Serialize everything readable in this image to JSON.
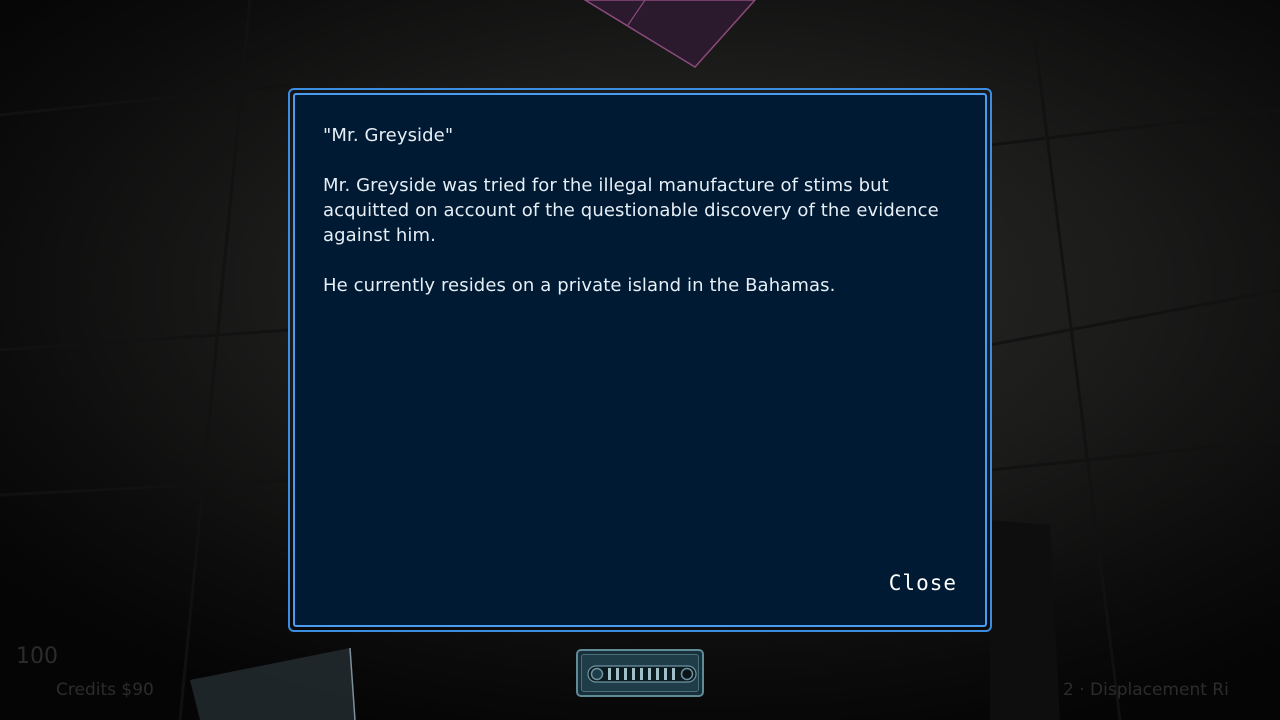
{
  "dialog": {
    "title": "\"Mr. Greyside\"",
    "paragraphs": [
      "Mr. Greyside was tried for the illegal manufacture of stims but acquitted on account of the questionable discovery of the evidence against him.",
      "He currently resides on a private island in the Bahamas."
    ],
    "close_label": "Close"
  },
  "hud": {
    "health": "100",
    "credits": "Credits $90",
    "weapon": "2 · Displacement Ri"
  },
  "colors": {
    "dialog_background": "#001a33",
    "dialog_border": "#3c8ce0",
    "text": "#e6eef6"
  }
}
